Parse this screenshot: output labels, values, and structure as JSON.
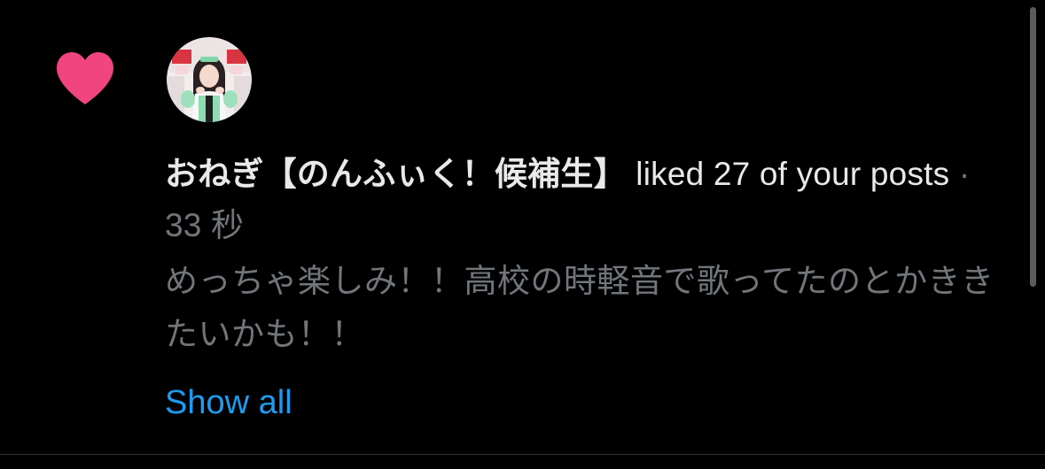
{
  "notification": {
    "type_icon": "heart-icon",
    "username": "おねぎ【のんふぃく！候補生】",
    "action_text": " liked 27 of your posts",
    "separator": " · ",
    "timestamp": "33 秒",
    "preview_text": "めっちゃ楽しみ！！高校の時軽音で歌ってたのとかききたいかも！！",
    "show_all_label": "Show all"
  },
  "colors": {
    "background": "#000000",
    "heart": "#f0457f",
    "primary_text": "#e7e9ea",
    "secondary_text": "#71767b",
    "link": "#1d9bf0"
  }
}
